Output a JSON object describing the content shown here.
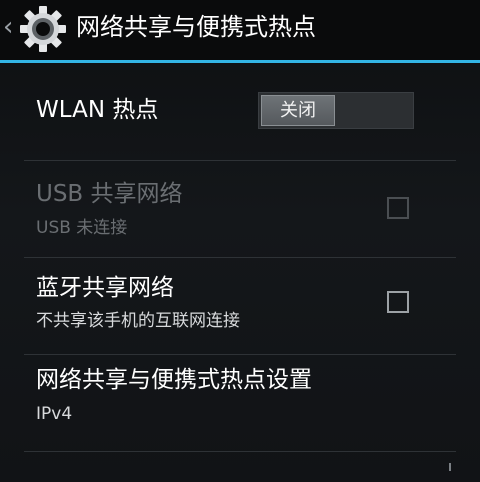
{
  "action_bar": {
    "back_glyph": "‹",
    "icon": "gear-icon",
    "title": "网络共享与便携式热点",
    "accent_color": "#33b5e5"
  },
  "items": {
    "wlan_hotspot": {
      "label": "WLAN 热点",
      "switch_text": "关闭",
      "switch_state": "off"
    },
    "usb_tethering": {
      "label": "USB 共享网络",
      "summary": "USB 未连接",
      "enabled": false,
      "checked": false
    },
    "bluetooth_tethering": {
      "label": "蓝牙共享网络",
      "summary": "不共享该手机的互联网连接",
      "enabled": true,
      "checked": false
    },
    "hotspot_settings": {
      "label": "网络共享与便携式热点设置",
      "summary": "IPv4"
    }
  }
}
